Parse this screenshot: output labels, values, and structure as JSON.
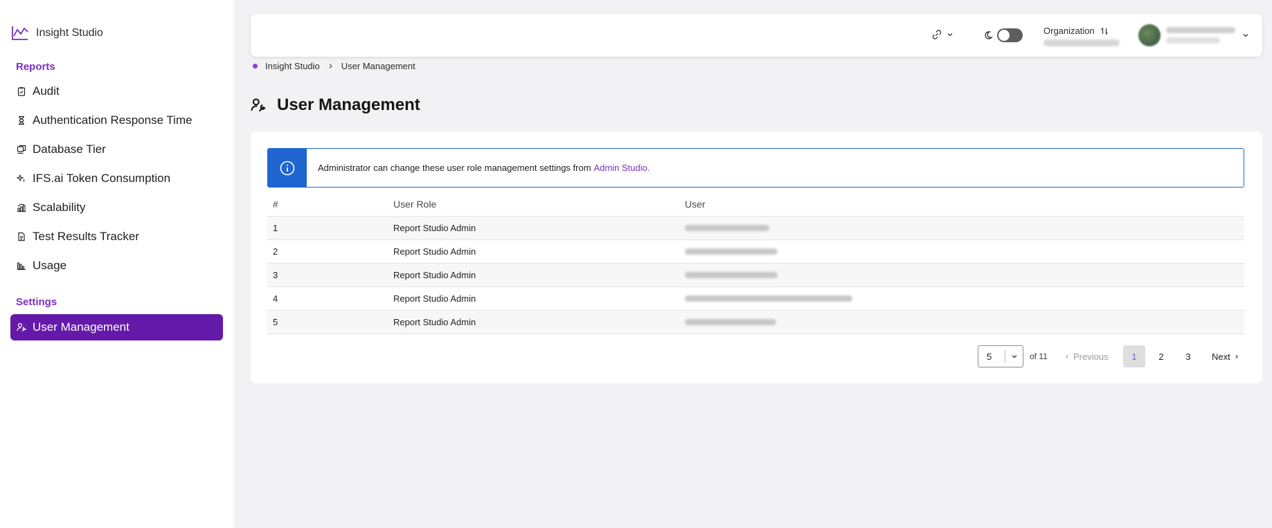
{
  "app": {
    "title": "Insight Studio"
  },
  "sidebar": {
    "reports_title": "Reports",
    "reports": [
      {
        "label": "Audit",
        "icon": "clipboard-icon"
      },
      {
        "label": "Authentication Response Time",
        "icon": "hourglass-icon"
      },
      {
        "label": "Database Tier",
        "icon": "database-icon"
      },
      {
        "label": "IFS.ai Token Consumption",
        "icon": "sparkle-icon"
      },
      {
        "label": "Scalability",
        "icon": "scale-icon"
      },
      {
        "label": "Test Results Tracker",
        "icon": "document-icon"
      },
      {
        "label": "Usage",
        "icon": "bar-chart-icon"
      }
    ],
    "settings_title": "Settings",
    "settings": [
      {
        "label": "User Management",
        "icon": "wrench-user-icon",
        "active": true
      }
    ]
  },
  "header": {
    "organization_label": "Organization"
  },
  "breadcrumb": {
    "items": [
      "Insight Studio",
      "User Management"
    ]
  },
  "page": {
    "title": "User Management"
  },
  "banner": {
    "text": "Administrator can change these user role management settings from",
    "link": "Admin Studio."
  },
  "table": {
    "headers": [
      "#",
      "User Role",
      "User"
    ],
    "rows": [
      {
        "num": "1",
        "role": "Report Studio Admin"
      },
      {
        "num": "2",
        "role": "Report Studio Admin"
      },
      {
        "num": "3",
        "role": "Report Studio Admin"
      },
      {
        "num": "4",
        "role": "Report Studio Admin"
      },
      {
        "num": "5",
        "role": "Report Studio Admin"
      }
    ]
  },
  "pagination": {
    "page_size": "5",
    "of_total": "of 11",
    "previous": "Previous",
    "pages": [
      "1",
      "2",
      "3"
    ],
    "current_page": "1",
    "next": "Next"
  },
  "colors": {
    "accent": "#6419a8",
    "section_title": "#7b2fbe",
    "info": "#1f66d1"
  }
}
